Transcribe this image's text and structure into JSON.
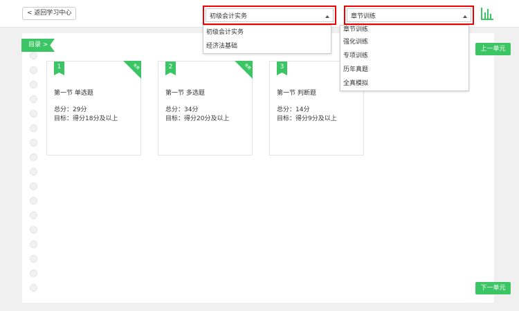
{
  "header": {
    "back_label": "< 返回学习中心",
    "subject_select": {
      "selected": "初级会计实务",
      "options": [
        "初级会计实务",
        "经济法基础"
      ]
    },
    "mode_select": {
      "selected": "章节训练",
      "options": [
        "章节训练",
        "强化训练",
        "专项训练",
        "历年真题",
        "全真模拟"
      ]
    },
    "chart_icon": "bar-chart-icon"
  },
  "catalog": {
    "label": "目录 >"
  },
  "cards": [
    {
      "num": "1",
      "badge": "免费",
      "title": "第一节 单选题",
      "score": "总分：29分",
      "target": "目标：得分18分及以上"
    },
    {
      "num": "2",
      "badge": "免费",
      "title": "第一节 多选题",
      "score": "总分：34分",
      "target": "目标：得分20分及以上"
    },
    {
      "num": "3",
      "title": "第一节 判断题",
      "score": "总分：14分",
      "target": "目标：得分9分及以上"
    }
  ],
  "nav": {
    "prev": "上一单元",
    "next": "下一单元"
  },
  "colors": {
    "accent": "#3cc564",
    "highlight": "#ee0000"
  }
}
